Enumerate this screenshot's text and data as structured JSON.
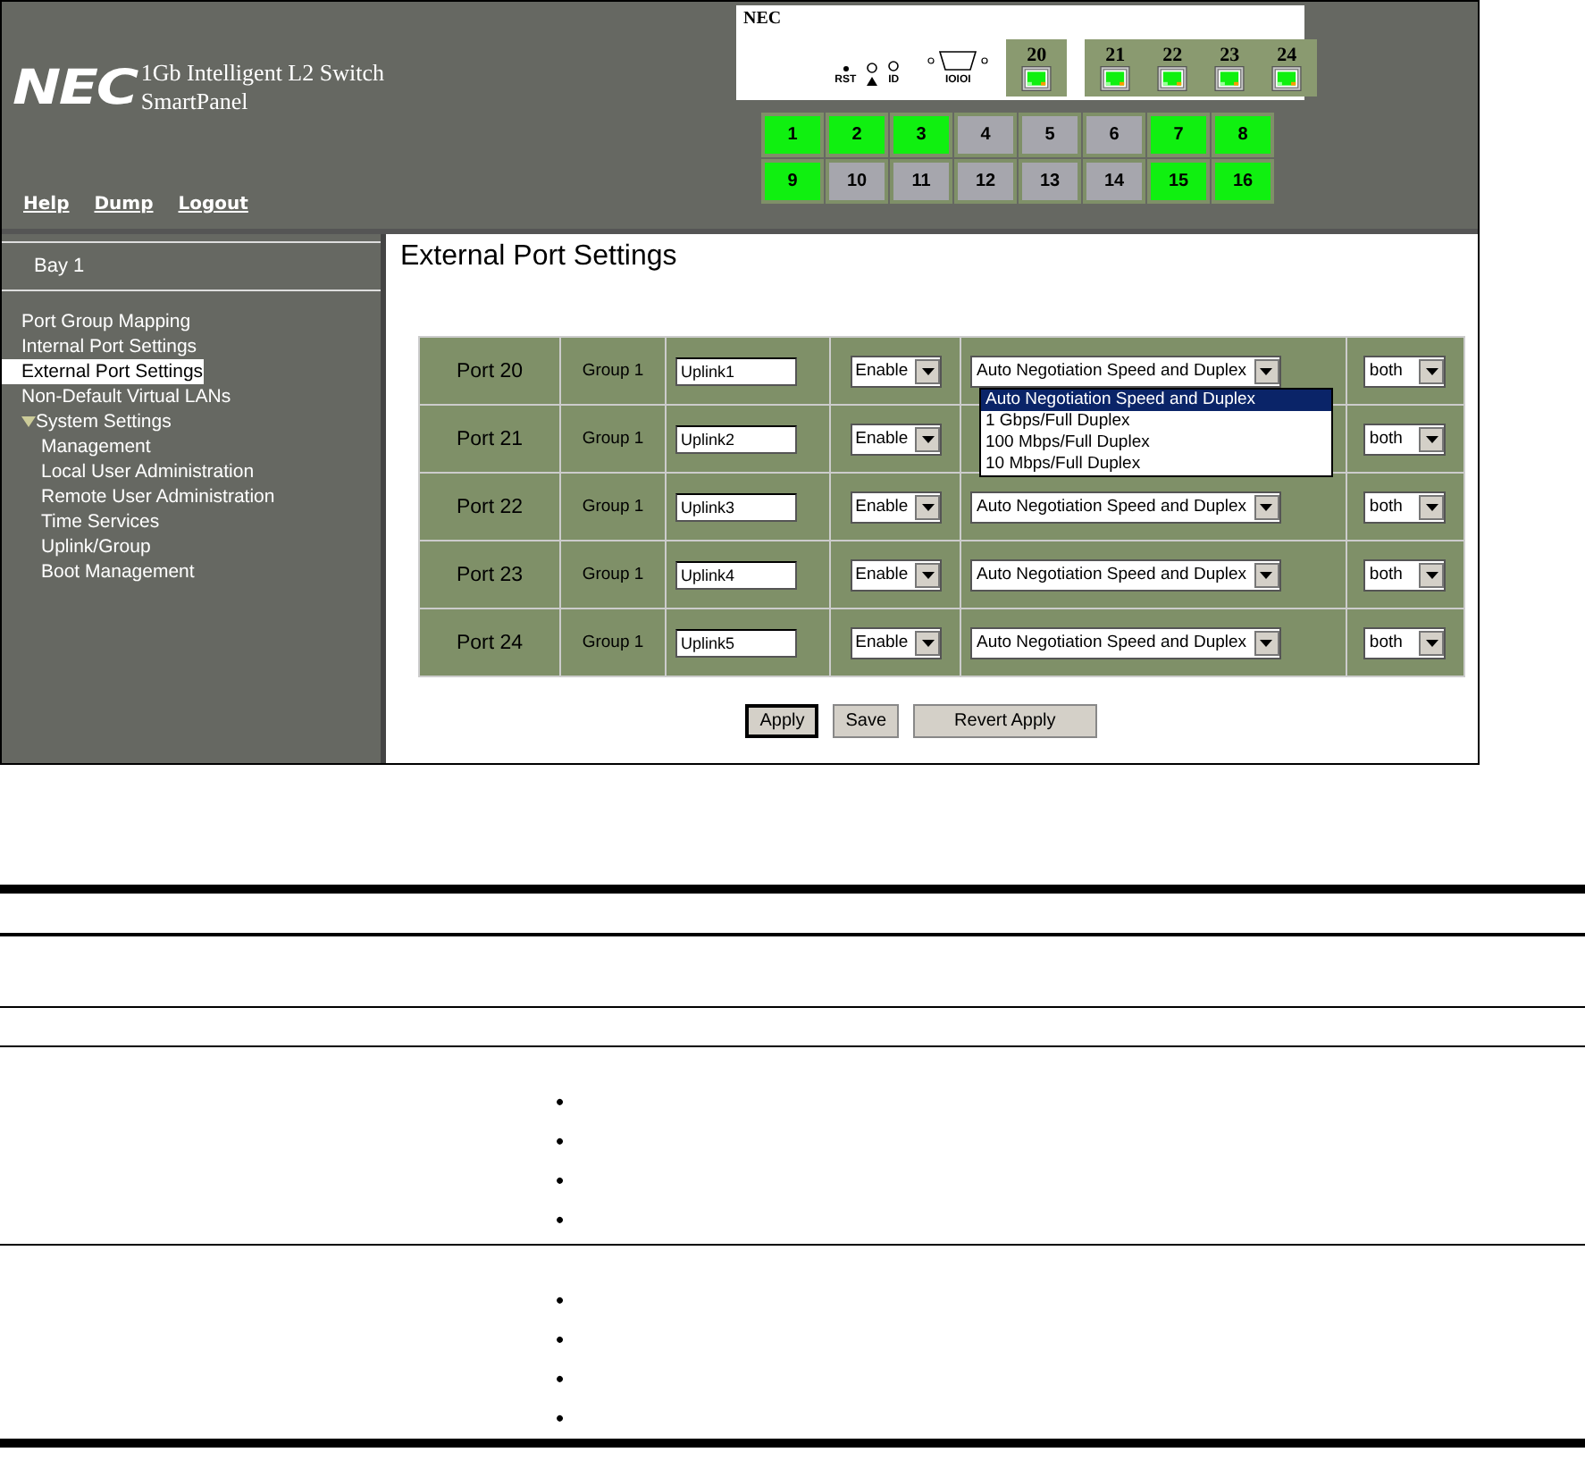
{
  "header": {
    "brand": "NEC",
    "title": "1Gb Intelligent L2 Switch",
    "subtitle": "SmartPanel",
    "links": [
      "Help",
      "Dump",
      "Logout"
    ]
  },
  "front_panel": {
    "brand": "NEC",
    "reset_label": "RST",
    "id_label": "ID",
    "serial_label": "IOIOI",
    "uplink_ports": [
      {
        "label": "20",
        "active": true
      },
      {
        "label": "21",
        "active": true
      },
      {
        "label": "22",
        "active": true
      },
      {
        "label": "23",
        "active": true
      },
      {
        "label": "24",
        "active": true
      }
    ]
  },
  "internal_ports": [
    {
      "label": "1",
      "active": true
    },
    {
      "label": "2",
      "active": true
    },
    {
      "label": "3",
      "active": true
    },
    {
      "label": "4",
      "active": false
    },
    {
      "label": "5",
      "active": false
    },
    {
      "label": "6",
      "active": false
    },
    {
      "label": "7",
      "active": true
    },
    {
      "label": "8",
      "active": true
    },
    {
      "label": "9",
      "active": true
    },
    {
      "label": "10",
      "active": false
    },
    {
      "label": "11",
      "active": false
    },
    {
      "label": "12",
      "active": false
    },
    {
      "label": "13",
      "active": false
    },
    {
      "label": "14",
      "active": false
    },
    {
      "label": "15",
      "active": true
    },
    {
      "label": "16",
      "active": true
    }
  ],
  "sidebar": {
    "bay": "Bay 1",
    "items": [
      {
        "label": "Port Group Mapping",
        "selected": false
      },
      {
        "label": "Internal Port Settings",
        "selected": false
      },
      {
        "label": "External Port Settings",
        "selected": true
      },
      {
        "label": "Non-Default Virtual LANs",
        "selected": false
      },
      {
        "label": "System Settings",
        "selected": false,
        "expanded": true,
        "children": [
          {
            "label": "Management",
            "selected": false
          },
          {
            "label": "Local User Administration",
            "selected": false
          },
          {
            "label": "Remote User Administration",
            "selected": false
          },
          {
            "label": "Time Services",
            "selected": false
          },
          {
            "label": "Uplink/Group",
            "selected": false
          },
          {
            "label": "Boot Management",
            "selected": false
          }
        ]
      }
    ]
  },
  "content": {
    "title": "External Port Settings",
    "rows": [
      {
        "port": "Port 20",
        "group": "Group 1",
        "name": "Uplink1",
        "state": "Enable",
        "speed": "Auto Negotiation Speed and Duplex",
        "flow": "both",
        "options": [
          {
            "label": "Auto Negotiation Speed and Duplex",
            "selected": true
          },
          {
            "label": "1 Gbps/Full Duplex",
            "selected": false
          },
          {
            "label": "100 Mbps/Full Duplex",
            "selected": false
          },
          {
            "label": "10 Mbps/Full Duplex",
            "selected": false
          }
        ]
      },
      {
        "port": "Port 21",
        "group": "Group 1",
        "name": "Uplink2",
        "state": "Enable",
        "flow": "both"
      },
      {
        "port": "Port 22",
        "group": "Group 1",
        "name": "Uplink3",
        "state": "Enable",
        "speed": "Auto Negotiation Speed and Duplex",
        "flow": "both"
      },
      {
        "port": "Port 23",
        "group": "Group 1",
        "name": "Uplink4",
        "state": "Enable",
        "speed": "Auto Negotiation Speed and Duplex",
        "flow": "both"
      },
      {
        "port": "Port 24",
        "group": "Group 1",
        "name": "Uplink5",
        "state": "Enable",
        "speed": "Auto Negotiation Speed and Duplex",
        "flow": "both"
      }
    ],
    "buttons": [
      {
        "label": "Apply",
        "focused": true
      },
      {
        "label": "Save",
        "focused": false
      },
      {
        "label": "Revert Apply",
        "focused": false
      }
    ]
  },
  "doc_table": {
    "rows": [
      {
        "bullets": []
      },
      {
        "bullets": []
      },
      {
        "bullets": [
          "•",
          "•",
          "•",
          "•"
        ]
      },
      {
        "bullets": [
          "•",
          "•",
          "•",
          "•"
        ]
      }
    ]
  }
}
